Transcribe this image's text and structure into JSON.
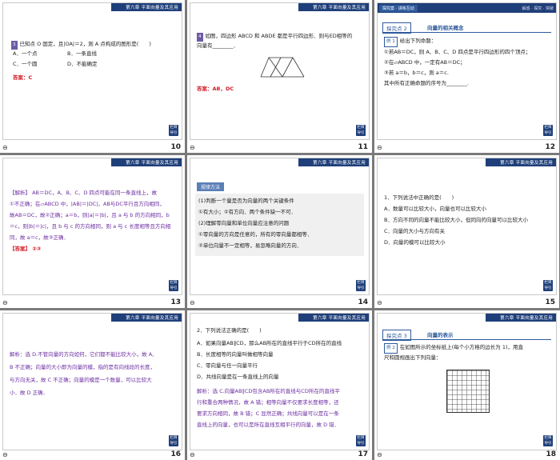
{
  "header_chapter": "第六章  平面向量及其应用",
  "return_label": "栏目导引",
  "note_glyph": "⊖",
  "slides": {
    "s10": {
      "number": "10",
      "q_num": "3",
      "q_text_1": "已知点 O 固定，且|OA|＝2，则 A 点构成的图形是(　　)",
      "opt_a": "A．一个点",
      "opt_b": "B．一条直线",
      "opt_c": "C．一个圆",
      "opt_d": "D．不能确定",
      "answer": "答案：C"
    },
    "s11": {
      "number": "11",
      "q_num": "4",
      "q_text_1": "如图，四边形 ABCD 和 ABDE 都是平行四边形．则与ED相等的",
      "q_text_2": "向量有________．",
      "answer": "答案：AB，DC"
    },
    "s12": {
      "number": "12",
      "tag": "探究案 · 讲练互动",
      "sub": "解惑 · 探究 · 突破",
      "section_label": "探究点 2",
      "section_title": "向量的相关概念",
      "ex_label": "例 1",
      "line_1": "给出下列命题：",
      "line_2": "①若AB＝DC，则 A、B、C、D 四点是平行四边形的四个顶点；",
      "line_3": "②在▱ABCD 中，一定有AB＝DC；",
      "line_4": "③若 a＝b，b＝c，则 a＝c.",
      "line_5": "其中所有正确命题的序号为________."
    },
    "s13": {
      "number": "13",
      "line_1": "【解析】 AB＝DC，A、B、C、D 四点可能在同一条直线上，故",
      "line_2": "①不正确；在▱ABCD 中，|AB|＝|DC|，AB与DC平行且方向相同，",
      "line_3": "故AB＝DC，故②正确；a＝b，则|a|＝|b|，且 a 与 b 的方向相同，b",
      "line_4": "＝c，则|b|＝|c|，且 b 与 c 的方向相同，则 a 与 c 长度相等且方向相",
      "line_5": "同，故 a＝c，故③正确．",
      "answer": "【答案】 ②③"
    },
    "s14": {
      "number": "14",
      "tag": "规律方法",
      "line_1": "(1)判断一个量是否为向量的两个关键条件",
      "line_2": "①有大小；②有方向．两个条件缺一不可．",
      "line_3": "(2)理解零向量和单位向量应注意的问题",
      "line_4": "①零向量的方向是任意的，所有的零向量都相等．",
      "line_5": "②单位向量不一定相等，易忽略向量的方向．"
    },
    "s15": {
      "number": "15",
      "line_1": "1．下列说法中正确的是(　　)",
      "line_2": "A．数量可以比较大小，向量也可以比较大小",
      "line_3": "B．方向不同的向量不能比较大小，但同向的向量可以比较大小",
      "line_4": "C．向量的大小与方向有关",
      "line_5": "D．向量的模可以比较大小"
    },
    "s16": {
      "number": "16",
      "line_1": "解析：选 D.不管向量的方向如何，它们都不能比较大小，故 A、",
      "line_2": "B 不正确；向量的大小即为向量的模，指的是有向线段的长度，",
      "line_3": "与方向无关，故 C 不正确；向量的模是一个数量，可以比较大",
      "line_4": "小．故 D 正确．"
    },
    "s17": {
      "number": "17",
      "line_1": "2．下列说法正确的是(　　)",
      "line_2": "A．如果向量AB∥CD，那么AB所在的直线平行于CD所在的直线",
      "line_3": "B．长度相等的向量叫做相等向量",
      "line_4": "C．零向量与任一向量平行",
      "line_5": "D．共线向量是在一条直线上的向量",
      "exp_1": "解析：选 C.向量AB∥CD包含AB所在的直线与CD所在的直线平",
      "exp_2": "行和重合两种情况，故 A 错；相等向量不仅要求长度相等，还",
      "exp_3": "要求方向相同，故 B 错；C 显然正确；共线向量可以是在一条",
      "exp_4": "直线上的向量，也可以是所在直线互相平行的向量，故 D 错．"
    },
    "s18": {
      "number": "18",
      "section_label": "探究点 3",
      "section_title": "向量的表示",
      "ex_label": "例 2",
      "line_1": "在如图所示的坐标纸上(每个小方格的边长为 1)，用直",
      "line_2": "尺和圆规画出下列向量："
    }
  }
}
